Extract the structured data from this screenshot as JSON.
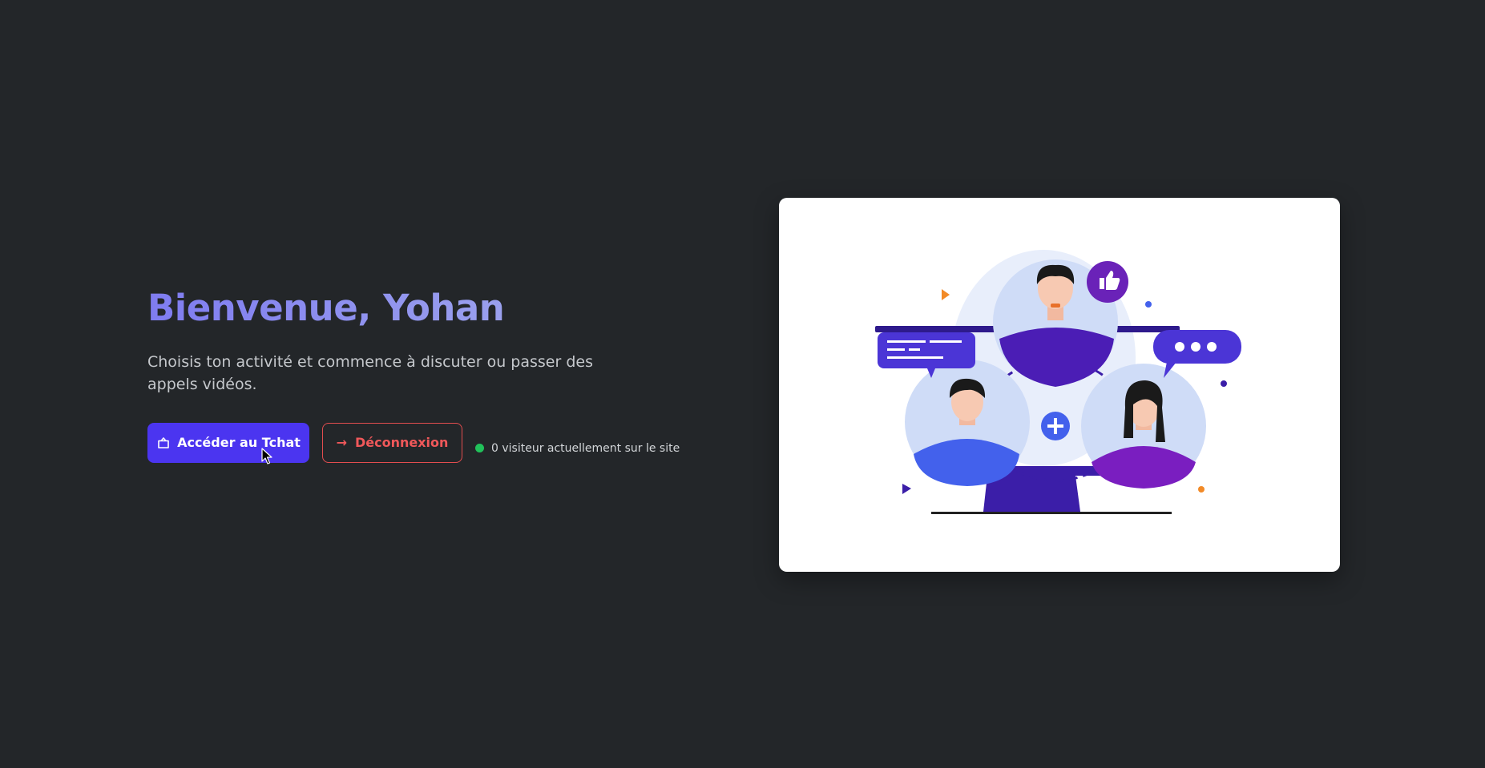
{
  "hero": {
    "greeting": "Bienvenue, Yohan",
    "subtitle": "Choisis ton activité et commence à discuter ou passer des appels vidéos.",
    "primary_button": {
      "label": "Accéder au Tchat",
      "icon": "chat-bubble-icon"
    },
    "logout_button": {
      "label": "Déconnexion",
      "icon": "arrow-right-icon"
    },
    "status": {
      "text": "0 visiteur actuellement sur le site",
      "dot_color": "#21c15a"
    }
  },
  "colors": {
    "background": "#232629",
    "primary": "#4b35f0",
    "danger": "#e24d4f",
    "title_gradient_start": "#7f7cf0",
    "title_gradient_end": "#9aa0ee"
  },
  "illustration": {
    "name": "video-call-people-illustration"
  }
}
